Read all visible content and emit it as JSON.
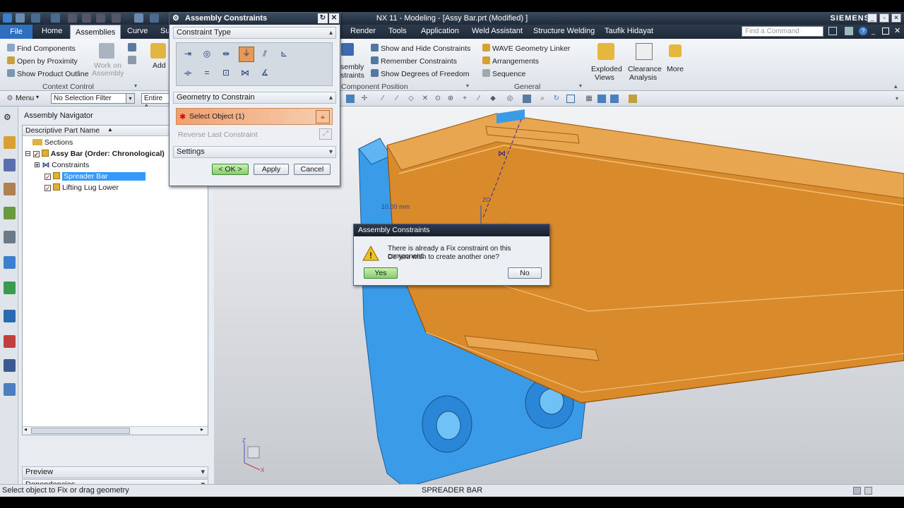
{
  "app": {
    "title": "NX 11 - Modeling - [Assy Bar.prt (Modified) ]",
    "brand": "SIEMENS"
  },
  "menu": {
    "file": "File",
    "tabs": [
      "Home",
      "Assemblies",
      "Curve",
      "Su",
      "Render",
      "Tools",
      "Application",
      "Weld Assistant",
      "Structure Welding",
      "Taufik Hidayat"
    ],
    "find_command_placeholder": "Find a Command"
  },
  "ribbon": {
    "context": {
      "find_components": "Find Components",
      "open_by_proximity": "Open by Proximity",
      "show_product_outline": "Show Product Outline",
      "work_on_assembly_1": "Work on",
      "work_on_assembly_2": "Assembly",
      "add": "Add",
      "group": "Context Control"
    },
    "component_position": {
      "assembly_constraints_1": "sembly",
      "assembly_constraints_2": "straints",
      "show_hide": "Show and Hide Constraints",
      "remember": "Remember Constraints",
      "show_dof": "Show Degrees of Freedom",
      "group": "Component Position"
    },
    "general": {
      "wave": "WAVE Geometry Linker",
      "arrangements": "Arrangements",
      "sequence": "Sequence",
      "group": "General"
    },
    "exploded_1": "Exploded",
    "exploded_2": "Views",
    "clearance_1": "Clearance",
    "clearance_2": "Analysis",
    "more": "More"
  },
  "toolbar": {
    "menu": "Menu",
    "selection_filter": "No Selection Filter",
    "scope": "Entire A"
  },
  "navigator": {
    "title": "Assembly Navigator",
    "column": "Descriptive Part Name",
    "rows": [
      {
        "label": "Sections"
      },
      {
        "label": "Assy Bar (Order: Chronological)"
      },
      {
        "label": "Constraints"
      },
      {
        "label": "Spreader Bar"
      },
      {
        "label": "Lifting Lug Lower"
      }
    ],
    "preview": "Preview",
    "dependencies": "Dependencies"
  },
  "dialog": {
    "title": "Assembly Constraints",
    "constraint_type": "Constraint Type",
    "geometry_to_constrain": "Geometry to Constrain",
    "select_object": "Select Object (1)",
    "reverse_last": "Reverse Last Constraint",
    "settings": "Settings",
    "ok": "< OK >",
    "apply": "Apply",
    "cancel": "Cancel"
  },
  "message": {
    "title": "Assembly Constraints",
    "line1": "There is already a Fix constraint on this component.",
    "line2": "Do you wish to create another one?",
    "yes": "Yes",
    "no": "No"
  },
  "viewport": {
    "dim_label": "10.00 mm",
    "zc": "ZC"
  },
  "status": {
    "prompt": "Select object to Fix or drag geometry",
    "selection": "SPREADER BAR"
  },
  "colors": {
    "blue_part": "#3a9be8",
    "orange_part": "#d98a2a",
    "selected_row": "#3399ff"
  }
}
